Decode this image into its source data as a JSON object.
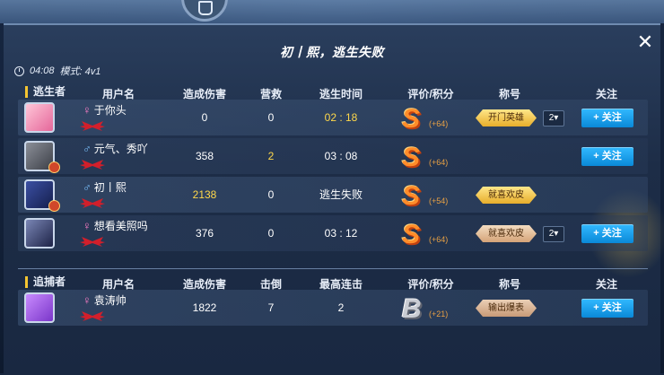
{
  "header": {
    "title": "初丨熙，逃生失败",
    "title_decor": "༺初丨熙༻",
    "time": "04:08",
    "mode": "模式: 4v1",
    "close_icon": "close-icon"
  },
  "survivors": {
    "role_label": "逃生者",
    "columns": [
      "用户名",
      "造成伤害",
      "营救",
      "逃生时间",
      "评价/积分",
      "称号",
      "关注"
    ],
    "rows": [
      {
        "sex": "♀",
        "name": "于你头",
        "damage": "0",
        "rescue": "0",
        "time": "02 : 18",
        "time_highlight": true,
        "grade": "S",
        "score": "(+64)",
        "title": "开门英雄",
        "title_style": "gold",
        "rank": "2",
        "has_follow": true
      },
      {
        "sex": "♂",
        "name": "元气、秀吖",
        "damage": "358",
        "rescue": "2",
        "rescue_highlight": true,
        "time": "03 : 08",
        "grade": "S",
        "score": "(+64)",
        "title": "",
        "has_follow": true
      },
      {
        "sex": "♂",
        "name": "初丨熙",
        "damage": "2138",
        "damage_highlight": true,
        "rescue": "0",
        "time": "逃生失败",
        "grade": "S",
        "score": "(+54)",
        "title": "就喜欢皮",
        "title_style": "gold",
        "has_follow": false
      },
      {
        "sex": "♀",
        "name": "想看美照吗",
        "damage": "376",
        "rescue": "0",
        "time": "03 : 12",
        "grade": "S",
        "score": "(+64)",
        "title": "就喜欢皮",
        "title_style": "pale",
        "rank": "2",
        "has_follow": true
      }
    ]
  },
  "hunters": {
    "role_label": "追捕者",
    "columns": [
      "用户名",
      "造成伤害",
      "击倒",
      "最高连击",
      "评价/积分",
      "称号",
      "关注"
    ],
    "rows": [
      {
        "sex": "♀",
        "name": "袁涛帅",
        "damage": "1822",
        "knockdowns": "7",
        "combo": "2",
        "grade": "B",
        "score": "(+21)",
        "title": "输出爆表",
        "title_style": "gray",
        "has_follow": true
      }
    ]
  },
  "follow_label": "+ 关注",
  "colors": {
    "accent": "#1aa2f0",
    "highlight": "#ffd84a",
    "grade_s": "#ff8d2a",
    "grade_b": "#c9ccd3",
    "role_bar": "#f5c531"
  }
}
